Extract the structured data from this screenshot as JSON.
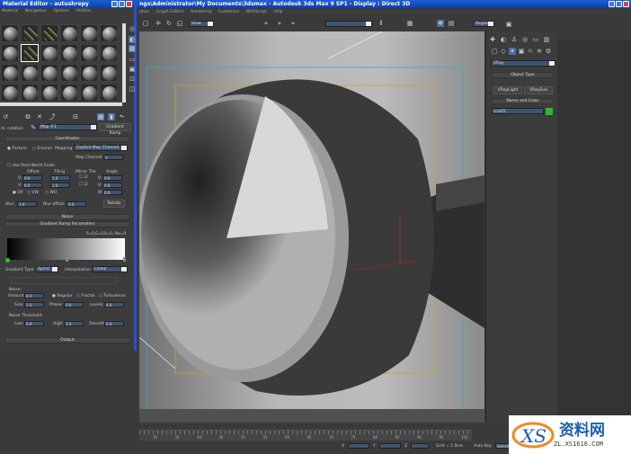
{
  "material_editor": {
    "title": "Material Editor - autushrepy",
    "menu": [
      "Material",
      "Navigation",
      "Options",
      "Utilities"
    ],
    "map_name": "Map #3",
    "map_type": "Gradient Ramp",
    "name_label": "m. rotation",
    "coordinates": {
      "header": "Coordinates",
      "texture": "Texture",
      "environ": "Environ",
      "mapping_label": "Mapping:",
      "mapping": "Explicit Map Channel",
      "map_channel_label": "Map Channel:",
      "map_channel": "1",
      "real_world": "Use Real-World Scale",
      "offset": "Offset",
      "tiling": "Tiling",
      "mirror_tile": "Mirror Tile",
      "angle": "Angle",
      "u": "U:",
      "v": "V:",
      "w": "W:",
      "u_offset": "0.0",
      "v_offset": "0.0",
      "u_tiling": "1.0",
      "v_tiling": "1.0",
      "u_angle": "0.0",
      "v_angle": "0.0",
      "w_angle": "0.0",
      "uv": "UV",
      "vw": "VW",
      "wu": "WU",
      "blur_label": "Blur:",
      "blur": "1.0",
      "blur_offset_label": "Blur offset:",
      "blur_offset": "0.0",
      "rotate": "Rotate"
    },
    "noise_header": "Noise",
    "gradient": {
      "header": "Gradient Ramp Parameters",
      "status": "R=0,G=0,B=0, Pos=0",
      "type_label": "Gradient Type:",
      "type": "Spiral",
      "interp_label": "Interpolation:",
      "interp": "Linear",
      "noise_label": "Noise:",
      "amount_label": "Amount:",
      "amount": "0.0",
      "regular": "Regular",
      "fractal": "Fractal",
      "turbulence": "Turbulence",
      "size_label": "Size:",
      "size": "1.0",
      "phase_label": "Phase:",
      "phase": "0.0",
      "levels_label": "Levels:",
      "levels": "4.0",
      "threshold_label": "Noise Threshold:",
      "low_label": "Low:",
      "low": "0.0",
      "high_label": "High:",
      "high": "1.0",
      "smooth_label": "Smooth:",
      "smooth": "0.0"
    },
    "output_header": "Output"
  },
  "main": {
    "title": "ngs\\Administrator\\My Documents\\3dsmax   - Autodesk 3ds Max 9 SP1   - Display : Direct 3D",
    "menu": [
      "ation",
      "Graph Editors",
      "Rendering",
      "Customize",
      "MAXScript",
      "Help"
    ],
    "view_dropdown": "View",
    "region_dropdown": "Region"
  },
  "command_panel": {
    "renderer": "VRay",
    "object_type_header": "Object Type",
    "buttons": [
      "VRayLight",
      "VRaySun"
    ],
    "name_color_header": "Name and Color",
    "object_name": "Line02",
    "object_color": "#22c022"
  },
  "timeline": {
    "ticks": [
      "30",
      "35",
      "40",
      "45",
      "50",
      "55",
      "60",
      "65",
      "70",
      "75",
      "80",
      "85",
      "90",
      "95",
      "100"
    ],
    "grid": "Grid = 1.0cm",
    "x_label": "X",
    "y_label": "Y",
    "z_label": "Z",
    "auto_key": "Auto Key",
    "selected": "Selected"
  },
  "watermark": {
    "brand": "资料网",
    "url": "ZL.XS1616.COM"
  }
}
